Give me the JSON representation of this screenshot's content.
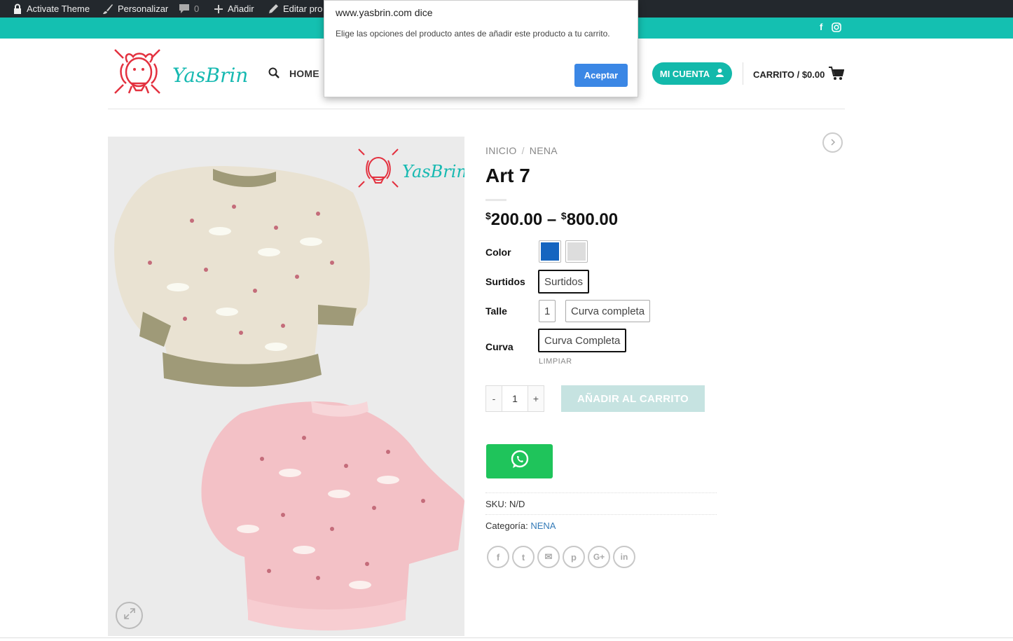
{
  "admin_bar": {
    "items": [
      {
        "label": "Activate Theme",
        "icon": "lock-icon"
      },
      {
        "label": "Personalizar",
        "icon": "brush-icon"
      },
      {
        "label": "0",
        "icon": "comment-icon"
      },
      {
        "label": "Añadir",
        "icon": "plus-icon"
      },
      {
        "label": "Editar pro",
        "icon": "pencil-icon"
      }
    ]
  },
  "top_bar": {
    "socials": [
      "facebook-icon",
      "instagram-icon"
    ],
    "facebook_label": "f",
    "bg_color": "#14c0b1"
  },
  "header": {
    "logo_text": "YasBrin",
    "nav": {
      "home_label": "HOME"
    },
    "account_label": "MI CUENTA",
    "cart_label": "CARRITO / $0.00"
  },
  "product": {
    "breadcrumb": [
      "INICIO",
      "NENA"
    ],
    "breadcrumb_sep": "/",
    "title": "Art 7",
    "price": {
      "currency": "$",
      "min": "200.00",
      "dash": "–",
      "max": "800.00"
    },
    "options": {
      "color_label": "Color",
      "color_swatches": [
        "#1565c0",
        "#dddddd"
      ],
      "surtidos_label": "Surtidos",
      "surtidos_value": "Surtidos",
      "talle_label": "Talle",
      "talle_values": [
        "1",
        "Curva completa"
      ],
      "curva_label": "Curva",
      "curva_value": "Curva Completa",
      "reset_label": "LIMPIAR"
    },
    "quantity": {
      "minus": "-",
      "value": "1",
      "plus": "+"
    },
    "add_to_cart_label": "AÑADIR AL CARRITO",
    "sku_label": "SKU:",
    "sku_value": "N/D",
    "category_label": "Categoría:",
    "category_value": "NENA",
    "share_icons": [
      "facebook-icon",
      "twitter-icon",
      "email-icon",
      "pinterest-icon",
      "google-plus-icon",
      "linkedin-icon"
    ],
    "share_glyphs": [
      "f",
      "t",
      "✉",
      "p",
      "G+",
      "in"
    ],
    "gallery_logo_text": "YasBrin"
  },
  "dialog": {
    "title": "www.yasbrin.com dice",
    "message": "Elige las opciones del producto antes de añadir este producto a tu carrito.",
    "ok_label": "Aceptar"
  }
}
